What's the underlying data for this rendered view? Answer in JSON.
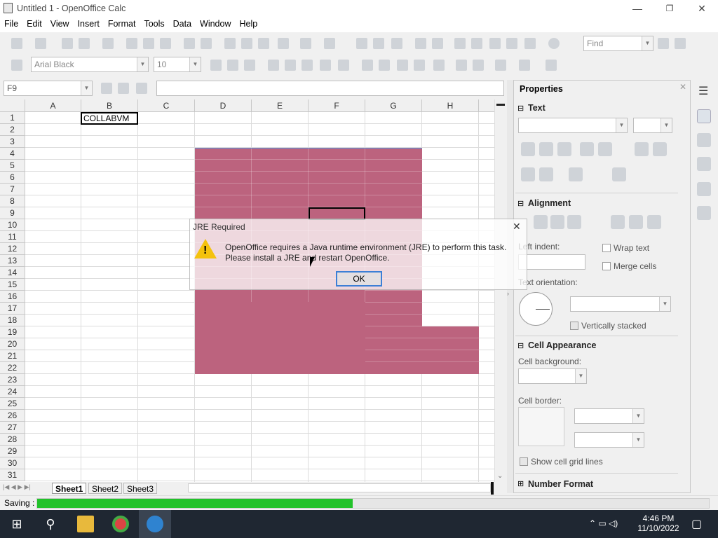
{
  "window": {
    "title": "Untitled 1 - OpenOffice Calc",
    "minimize": "—",
    "maximize": "❐",
    "close": "✕"
  },
  "menu": [
    "File",
    "Edit",
    "View",
    "Insert",
    "Format",
    "Tools",
    "Data",
    "Window",
    "Help"
  ],
  "toolbar": {
    "find_placeholder": "Find",
    "font_name": "Arial Black",
    "font_size": "10"
  },
  "formula_bar": {
    "name_box": "F9",
    "formula": ""
  },
  "sheet": {
    "columns": [
      "A",
      "B",
      "C",
      "D",
      "E",
      "F",
      "G",
      "H"
    ],
    "rows": [
      "1",
      "2",
      "3",
      "4",
      "5",
      "6",
      "7",
      "8",
      "9",
      "10",
      "11",
      "12",
      "13",
      "14",
      "15",
      "16",
      "17",
      "18",
      "19",
      "20",
      "21",
      "22",
      "23",
      "24",
      "25",
      "26",
      "27",
      "28",
      "29",
      "30",
      "31"
    ],
    "cell_b1": "COLLABVM",
    "tabs": [
      "Sheet1",
      "Sheet2",
      "Sheet3"
    ],
    "active_tab": "Sheet1",
    "fill_color": "#bc637e"
  },
  "status": {
    "label": "Saving :",
    "progress": 0.47,
    "progress_color": "#22c22a"
  },
  "sidebar": {
    "title": "Properties",
    "text_section": "Text",
    "alignment_section": "Alignment",
    "left_indent": "Left indent:",
    "wrap_text": "Wrap text",
    "merge_cells": "Merge cells",
    "text_orientation": "Text orientation:",
    "vertically_stacked": "Vertically stacked",
    "cell_appearance_section": "Cell Appearance",
    "cell_background": "Cell background:",
    "cell_border": "Cell border:",
    "show_grid": "Show cell grid lines",
    "number_format_section": "Number Format"
  },
  "dialog": {
    "title": "JRE Required",
    "message": "OpenOffice requires a Java runtime environment (JRE) to perform this task. Please install a JRE and restart OpenOffice.",
    "ok": "OK"
  },
  "taskbar": {
    "time": "4:46 PM",
    "date": "11/10/2022"
  }
}
